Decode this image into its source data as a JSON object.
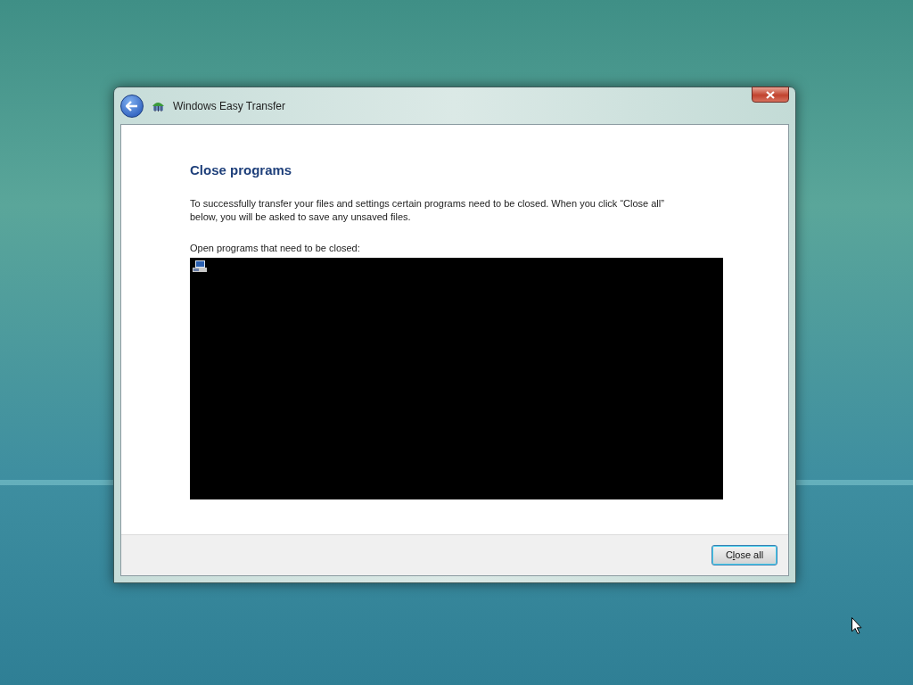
{
  "window": {
    "title": "Windows Easy Transfer"
  },
  "heading": "Close programs",
  "description": "To successfully transfer your files and settings certain programs need to be closed. When you click “Close all” below, you will be asked to save any unsaved files.",
  "list_label": "Open programs that need to be closed:",
  "programs": [
    {
      "kind": "app"
    }
  ],
  "buttons": [
    {
      "label_before_access_key": "C",
      "access_key": "l",
      "label_after_access_key": "ose all"
    }
  ]
}
